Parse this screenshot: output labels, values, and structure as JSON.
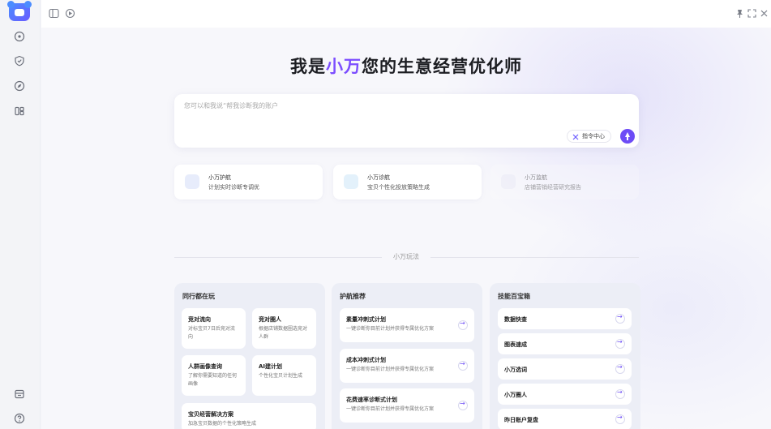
{
  "hero": {
    "prefix": "我是",
    "name": "小万",
    "suffix": "您的生意经营优化师"
  },
  "chat": {
    "placeholder": "您可以和我说“帮我诊断我的账户",
    "command_label": "指令中心"
  },
  "features": [
    {
      "title": "小万护航",
      "desc": "计划实时诊断专调优"
    },
    {
      "title": "小万诊航",
      "desc": "宝贝个性化投放策略生成"
    },
    {
      "title": "小万监航",
      "desc": "店铺营销经营研究报告"
    }
  ],
  "section_label": "小万玩法",
  "columns": [
    {
      "title": "同行都在玩",
      "tiles": [
        {
          "title": "竞对流向",
          "desc": "对标宝贝7日后竞对流向"
        },
        {
          "title": "竞对圈人",
          "desc": "根据店铺数据圈选竞对人群"
        },
        {
          "title": "人群画像查询",
          "desc": "了解你需要知道的任何画像"
        },
        {
          "title": "AI建计划",
          "desc": "个性化宝贝计划生成"
        },
        {
          "title": "宝贝经营解决方案",
          "desc": "加急宝贝数据的个性化策略生成"
        }
      ]
    },
    {
      "title": "护航推荐",
      "tiles": [
        {
          "title": "素量冲刺式计划",
          "desc": "一键诊断你目前计划并获得专属优化方案"
        },
        {
          "title": "成本冲刺式计划",
          "desc": "一键诊断你目前计划并获得专属优化方案"
        },
        {
          "title": "花费速率诊断式计划",
          "desc": "一键诊断你目前计划并获得专属优化方案"
        }
      ]
    },
    {
      "title": "技能百宝箱",
      "tiles": [
        {
          "title": "数据快查"
        },
        {
          "title": "图表速成"
        },
        {
          "title": "小万选词"
        },
        {
          "title": "小万圈人"
        },
        {
          "title": "昨日账户复盘"
        }
      ]
    }
  ]
}
